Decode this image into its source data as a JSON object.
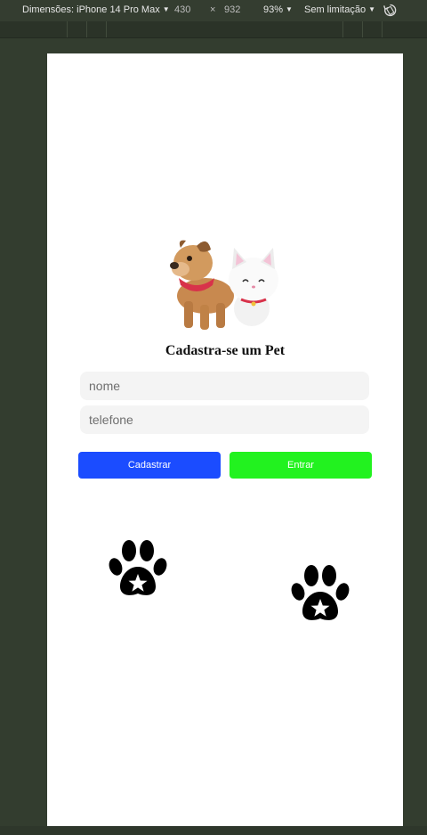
{
  "devtools": {
    "dimensions_label": "Dimensões: iPhone 14 Pro Max",
    "width_value": "430",
    "times": "×",
    "height_value": "932",
    "zoom": "93%",
    "throttle": "Sem limitação",
    "rotate_icon": "rotate-icon"
  },
  "app": {
    "image_icon": "dog-and-cat-illustration",
    "title": "Cadastra-se um Pet",
    "name_placeholder": "nome",
    "phone_placeholder": "telefone",
    "register_label": "Cadastrar",
    "enter_label": "Entrar",
    "paw_icon": "paw-icon"
  },
  "colors": {
    "register_button": "#1b4cff",
    "enter_button": "#22f21f",
    "input_bg": "#f4f4f4"
  }
}
